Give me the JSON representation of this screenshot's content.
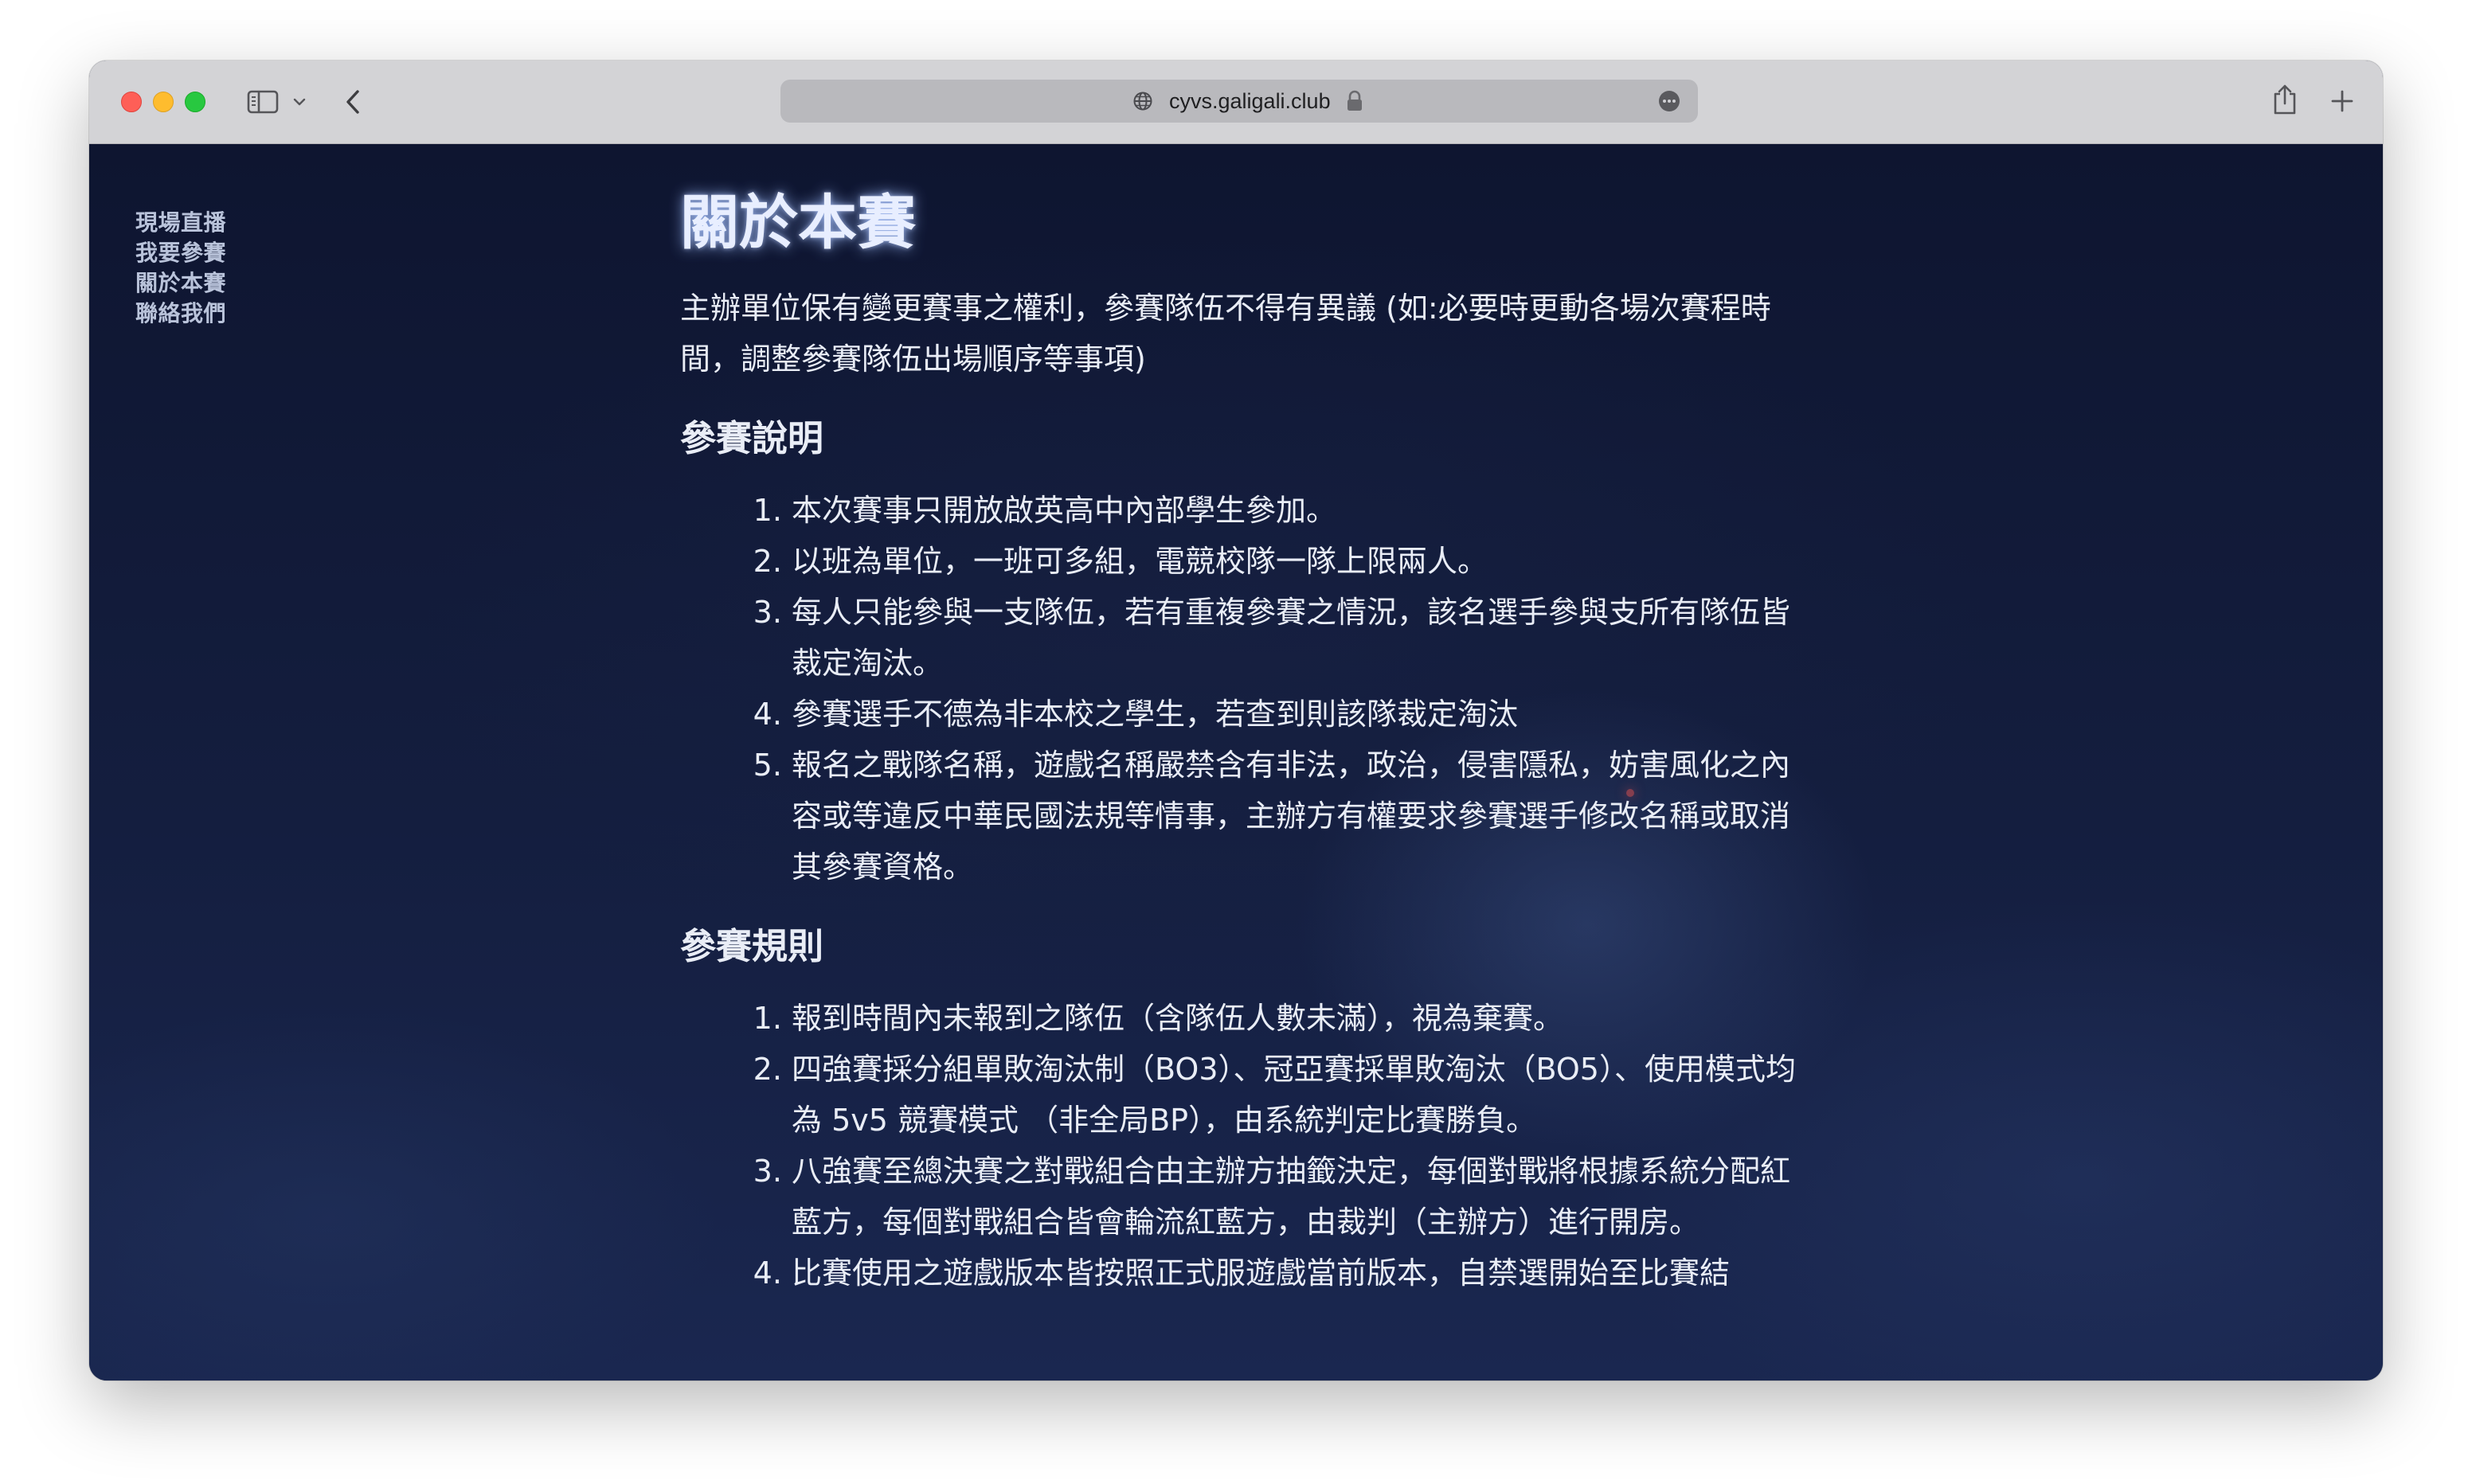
{
  "browser": {
    "url": "cyvs.galigali.club"
  },
  "nav": {
    "items": [
      "現場直播",
      "我要參賽",
      "關於本賽",
      "聯絡我們"
    ]
  },
  "article": {
    "title": "關於本賽",
    "intro": "主辦單位保有變更賽事之權利，參賽隊伍不得有異議 (如:必要時更動各場次賽程時間，調整參賽隊伍出場順序等事項)",
    "sections": [
      {
        "heading": "參賽說明",
        "items": [
          "本次賽事只開放啟英高中內部學生參加。",
          "以班為單位，一班可多組，電競校隊一隊上限兩人。",
          "每人只能參與一支隊伍，若有重複參賽之情況，該名選手參與支所有隊伍皆裁定淘汰。",
          "參賽選手不德為非本校之學生，若查到則該隊裁定淘汰",
          "報名之戰隊名稱，遊戲名稱嚴禁含有非法，政治，侵害隱私，妨害風化之內容或等違反中華民國法規等情事，主辦方有權要求參賽選手修改名稱或取消其參賽資格。"
        ]
      },
      {
        "heading": "參賽規則",
        "items": [
          "報到時間內未報到之隊伍（含隊伍人數未滿），視為棄賽。",
          "四強賽採分組單敗淘汰制（BO3）、冠亞賽採單敗淘汰（BO5）、使用模式均為 5v5 競賽模式 （非全局BP），由系統判定比賽勝負。",
          "八強賽至總決賽之對戰組合由主辦方抽籤決定，每個對戰將根據系統分配紅藍方，每個對戰組合皆會輪流紅藍方，由裁判（主辦方）進行開房。",
          "比賽使用之遊戲版本皆按照正式服遊戲當前版本，自禁選開始至比賽結"
        ]
      }
    ]
  }
}
